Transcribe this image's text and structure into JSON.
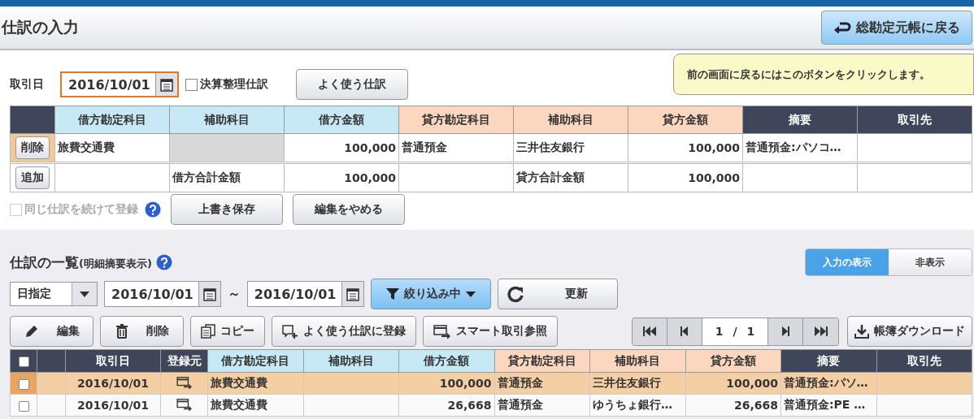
{
  "header": {
    "title": "仕訳の入力",
    "back_button": "総勘定元帳に戻る"
  },
  "tooltip": "前の画面に戻るにはこのボタンをクリックします。",
  "entry": {
    "date_label": "取引日",
    "date": "2016/10/01",
    "closing_checkbox": {
      "label": "決算整理仕訳",
      "checked": false
    },
    "favorites_button": "よく使う仕訳",
    "columns": [
      {
        "label": "借方勘定科目",
        "kind": "debit"
      },
      {
        "label": "補助科目",
        "kind": "debit"
      },
      {
        "label": "借方金額",
        "kind": "debit"
      },
      {
        "label": "貸方勘定科目",
        "kind": "credit"
      },
      {
        "label": "補助科目",
        "kind": "credit"
      },
      {
        "label": "貸方金額",
        "kind": "credit"
      },
      {
        "label": "摘要",
        "kind": "other"
      },
      {
        "label": "取引先",
        "kind": "other"
      }
    ],
    "row": {
      "action": "削除",
      "debit_account": "旅費交通費",
      "debit_sub_disabled": true,
      "debit_amount": "100,000",
      "credit_account": "普通預金",
      "credit_sub": "三井住友銀行",
      "credit_amount": "100,000",
      "memo": "普通預金:パソコ…"
    },
    "total_row": {
      "action": "追加",
      "debit_total_label": "借方合計金額",
      "debit_total": "100,000",
      "credit_total_label": "貸方合計金額",
      "credit_total": "100,000"
    },
    "repeat_checkbox": {
      "label": "同じ仕訳を続けて登録",
      "checked": false,
      "disabled": true
    },
    "buttons": [
      "上書き保存",
      "編集をやめる"
    ]
  },
  "list": {
    "title": "仕訳の一覧",
    "subtitle": "(明細摘要表示)",
    "toggle": [
      {
        "label": "入力の表示",
        "selected": true
      },
      {
        "label": "非表示",
        "selected": false
      }
    ],
    "period_select": "日指定",
    "date_from": "2016/10/01",
    "range_separator": "～",
    "date_to": "2016/10/01",
    "filter_button": "絞り込み中",
    "refresh_button": "更新",
    "toolbar": [
      {
        "label": "編集",
        "kind": "pencil"
      },
      {
        "label": "削除",
        "kind": "trash"
      },
      {
        "label": "コピー",
        "kind": "copy"
      },
      {
        "label": "よく使う仕訳に登録",
        "kind": "bookmark"
      },
      {
        "label": "スマート取引参照",
        "kind": "card"
      }
    ],
    "pager": {
      "page": "1",
      "separator": "/",
      "total": "1"
    },
    "download_button": "帳簿ダウンロード",
    "select_all_checked": false,
    "columns": [
      {
        "label": "取引日",
        "kind": "other"
      },
      {
        "label": "登録元",
        "kind": "other"
      },
      {
        "label": "借方勘定科目",
        "kind": "debit"
      },
      {
        "label": "補助科目",
        "kind": "debit"
      },
      {
        "label": "借方金額",
        "kind": "debit"
      },
      {
        "label": "貸方勘定科目",
        "kind": "credit"
      },
      {
        "label": "補助科目",
        "kind": "credit"
      },
      {
        "label": "貸方金額",
        "kind": "credit"
      },
      {
        "label": "摘要",
        "kind": "other"
      },
      {
        "label": "取引先",
        "kind": "other"
      }
    ],
    "rows": [
      {
        "selected": true,
        "checked": false,
        "date": "2016/10/01",
        "debit_account": "旅費交通費",
        "debit_amount": "100,000",
        "credit_account": "普通預金",
        "credit_sub": "三井住友銀行",
        "credit_amount": "100,000",
        "memo": "普通預金:パソ…"
      },
      {
        "selected": false,
        "checked": false,
        "date": "2016/10/01",
        "debit_account": "旅費交通費",
        "debit_amount": "26,668",
        "credit_account": "普通預金",
        "credit_sub": "ゆうちょ銀行…",
        "credit_amount": "26,668",
        "memo": "普通預金:PE …"
      }
    ]
  }
}
